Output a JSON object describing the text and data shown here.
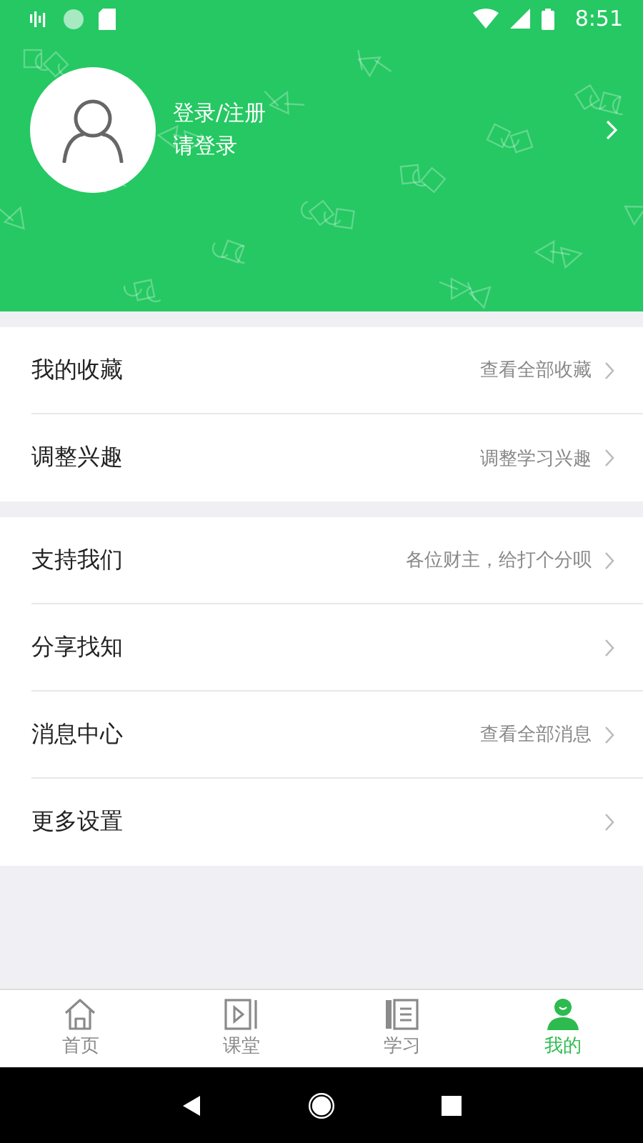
{
  "status_bar": {
    "time": "8:51"
  },
  "profile": {
    "title": "登录/注册",
    "subtitle": "请登录"
  },
  "groups": [
    {
      "items": [
        {
          "label": "我的收藏",
          "hint": "查看全部收藏"
        },
        {
          "label": "调整兴趣",
          "hint": "调整学习兴趣"
        }
      ]
    },
    {
      "items": [
        {
          "label": "支持我们",
          "hint": "各位财主，给打个分呗"
        },
        {
          "label": "分享找知"
        },
        {
          "label": "消息中心",
          "hint": "查看全部消息"
        },
        {
          "label": "更多设置"
        }
      ]
    }
  ],
  "tabs": [
    {
      "label": "首页",
      "kind": "home",
      "selected": false
    },
    {
      "label": "课堂",
      "kind": "class",
      "selected": false
    },
    {
      "label": "学习",
      "kind": "study",
      "selected": false
    },
    {
      "label": "我的",
      "kind": "me",
      "selected": true
    }
  ]
}
